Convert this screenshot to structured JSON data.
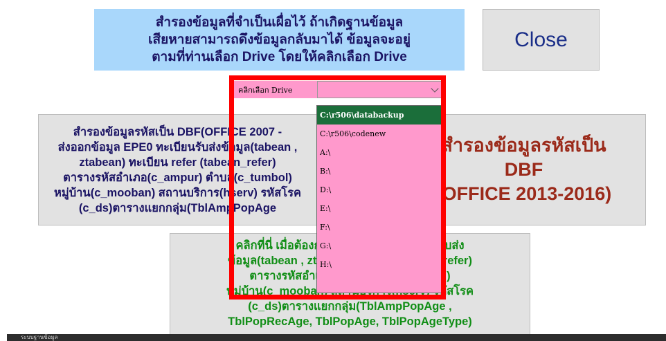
{
  "info": {
    "line1": "สำรองข้อมูลที่จำเป็นเผื่อไว้ ถ้าเกิดฐานข้อมูล",
    "line2": "เสียหายสามารถดึงข้อมูลกลับมาได้ ข้อมูลจะอยู่",
    "line3": "ตามที่ท่านเลือก Drive โดยให้คลิกเลือก Drive"
  },
  "close_label": "Close",
  "drive": {
    "label": "คลิกเลือก Drive",
    "value": "",
    "options": [
      "C:\\r506\\databackup",
      "C:\\r506\\codenew",
      "A:\\",
      "B:\\",
      "D:\\",
      "E:\\",
      "F:\\",
      "G:\\",
      "H:\\"
    ],
    "selected_index": 0
  },
  "backup2007": {
    "lines": [
      "สำรองข้อมูลรหัสเป็น DBF(OFFICE 2007 -",
      "ส่งออกข้อมูล EPE0 ทะเบียนรับส่งข้อมูล(tabean ,",
      "ztabean) ทะเบียน refer (tabean_refer)",
      "ตารางรหัสอำเภอ(c_ampur) ตำบล(c_tumbol)",
      "หมู่บ้าน(c_mooban) สถานบริการ(hserv) รหัสโรค",
      "(c_ds)ตารางแยกกลุ่ม(TblAmpPopAge"
    ]
  },
  "backup2013": {
    "lines": [
      "สำรองข้อมูลรหัสเป็น",
      "DBF",
      "(OFFICE 2013-2016)"
    ]
  },
  "export": {
    "lines": [
      "คลิกที่นี่ เมื่อต้องการส่งออกข้อมูล ทะเบียนรับส่ง",
      "ข้อมูล(tabean , ztabean) ทะเบียน(tabean_refer)",
      "ตารางรหัสอำเภอ(c_ampur) (c_tumbol)",
      "หมู่บ้าน(c_mooban) สถานบริการ(hserv) รหัสโรค",
      "(c_ds)ตารางแยกกลุ่ม(TblAmpPopAge ,",
      "TblPopRecAge, TblPopAge, TblPopAgeType)"
    ]
  },
  "status_text": "ระบบฐานข้อมูล",
  "colors": {
    "info_bg": "#a9d7fb",
    "dropdown_bg": "#ff99cc",
    "selected_option": "#1b6e3a",
    "highlight": "#ff0000",
    "export_text": "#118e16",
    "backup2013_text": "#9b2a1a"
  }
}
